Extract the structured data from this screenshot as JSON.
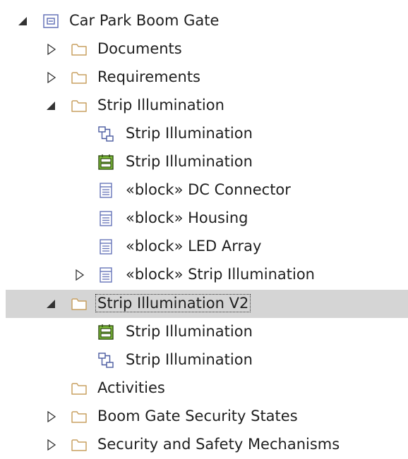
{
  "tree": {
    "root_label": "Car Park Boom Gate",
    "documents": "Documents",
    "requirements": "Requirements",
    "strip_pkg": "Strip Illumination",
    "strip_diagram": "Strip Illumination",
    "strip_ibd": "Strip Illumination",
    "block_dc": "«block» DC Connector",
    "block_housing": "«block» Housing",
    "block_led": "«block» LED Array",
    "block_strip": "«block» Strip Illumination",
    "strip_v2_pkg": "Strip Illumination V2",
    "v2_ibd": "Strip Illumination",
    "v2_diagram": "Strip Illumination",
    "activities": "Activities",
    "boom_states": "Boom Gate Security States",
    "security_mech": "Security and Safety Mechanisms"
  },
  "colors": {
    "selection": "#d5d5d5",
    "folder_stroke": "#c8a060",
    "block_stroke": "#6674b8",
    "ibd_fill": "#7fbf3a"
  }
}
